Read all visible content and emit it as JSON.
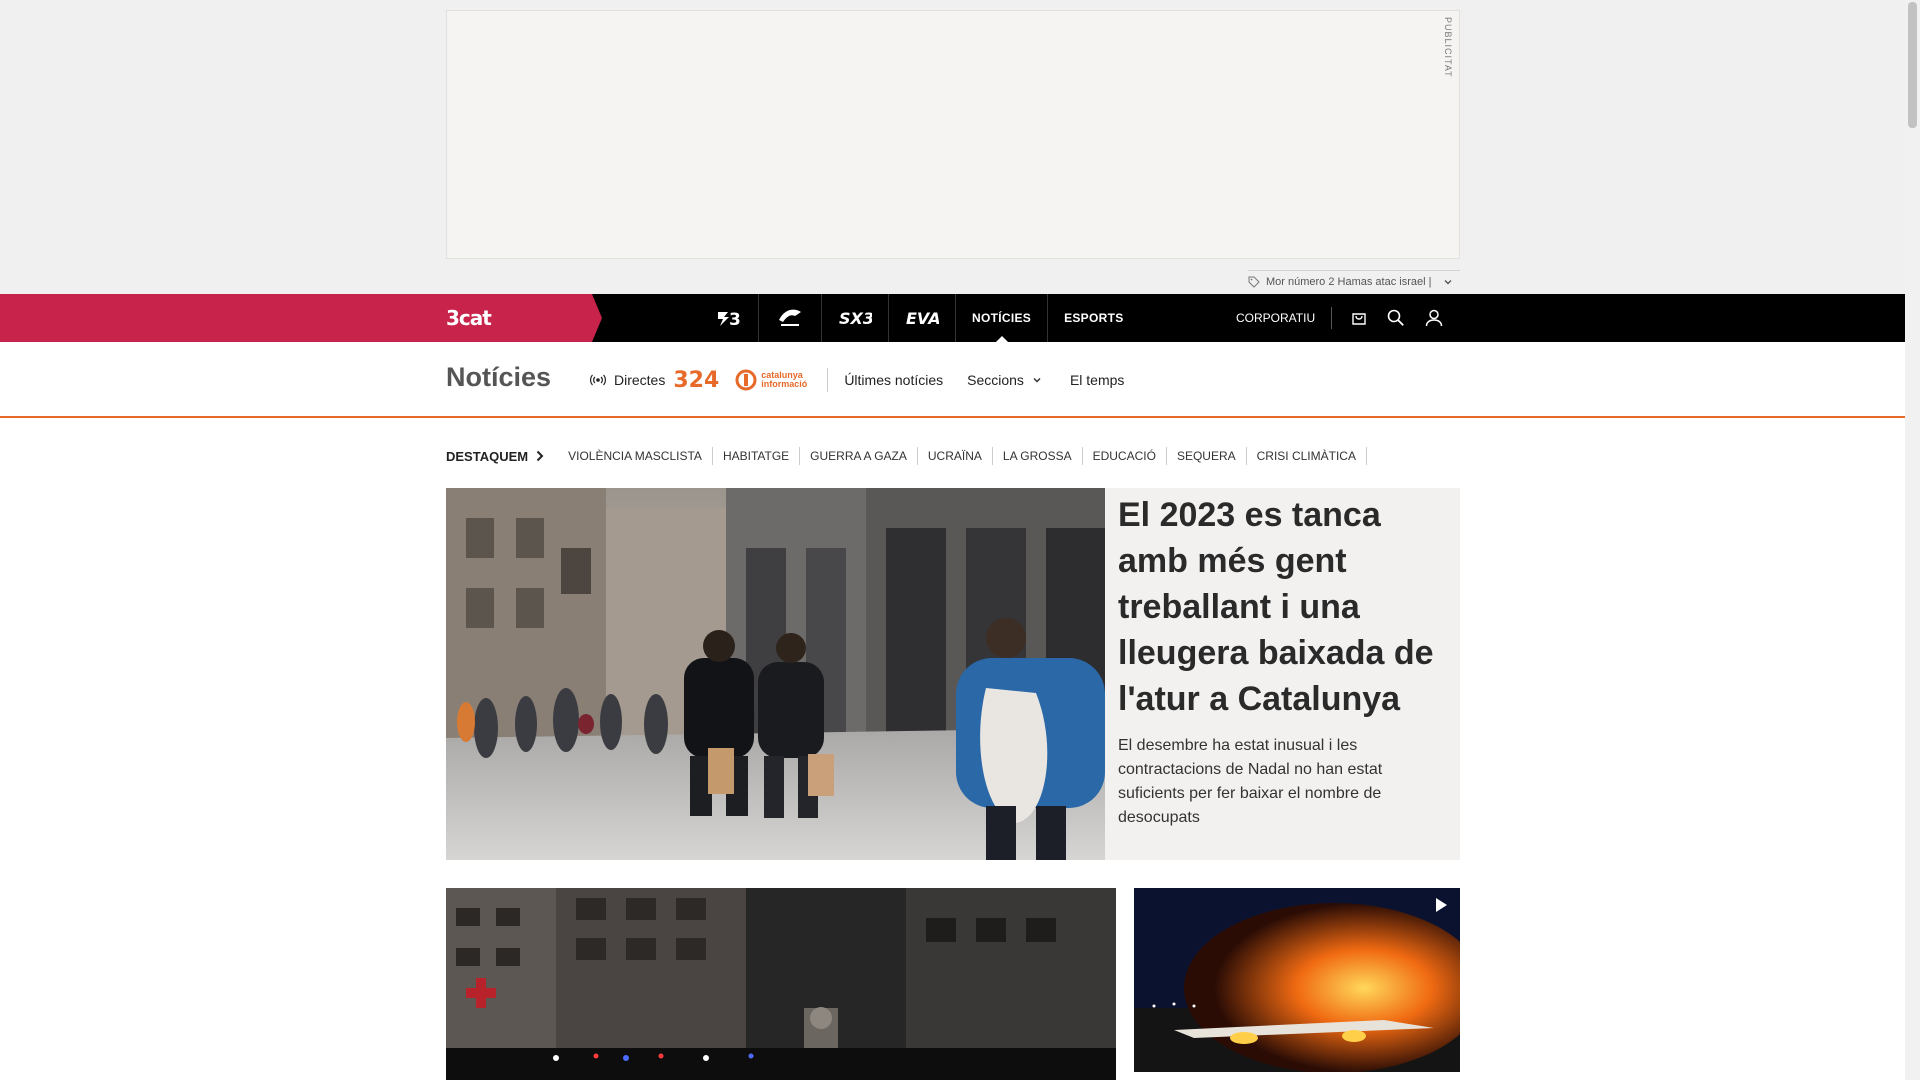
{
  "ad": {
    "tag": "PUBLICITAT",
    "footer_text": "Mor número 2 Hamas atac israel |"
  },
  "topbar": {
    "brand": "3cat",
    "channels": [
      {
        "label": "3",
        "name": "channel-tv3"
      },
      {
        "label": "Cat Ràdio",
        "name": "channel-catradio"
      },
      {
        "label": "SX3",
        "name": "channel-sx3"
      },
      {
        "label": "EVA",
        "name": "channel-eva"
      },
      {
        "label": "NOTÍCIES",
        "name": "channel-noticies"
      },
      {
        "label": "ESPORTS",
        "name": "channel-esports"
      }
    ],
    "corporatiu": "CORPORATIU"
  },
  "section": {
    "title": "Notícies",
    "live": "Directes",
    "logo_324": "324",
    "logo_ci_line1": "catalunya",
    "logo_ci_line2": "informació",
    "links": {
      "latest": "Últimes notícies",
      "sections": "Seccions",
      "weather": "El temps"
    }
  },
  "highlights": {
    "title": "DESTAQUEM",
    "items": [
      "VIOLÈNCIA MASCLISTA",
      "HABITATGE",
      "GUERRA A GAZA",
      "UCRAÏNA",
      "LA GROSSA",
      "EDUCACIÓ",
      "SEQUERA",
      "CRISI CLIMÀTICA"
    ]
  },
  "hero": {
    "title": "El 2023 es tanca amb més gent treballant i una lleugera baixada de l'atur a Catalunya",
    "subtitle": "El desembre ha estat inusual i les contractacions de Nadal no han estat suficients per fer baixar el nombre de desocupats"
  },
  "colors": {
    "brand": "#c8234a",
    "accent": "#e86a2a",
    "topbar": "#000000"
  }
}
